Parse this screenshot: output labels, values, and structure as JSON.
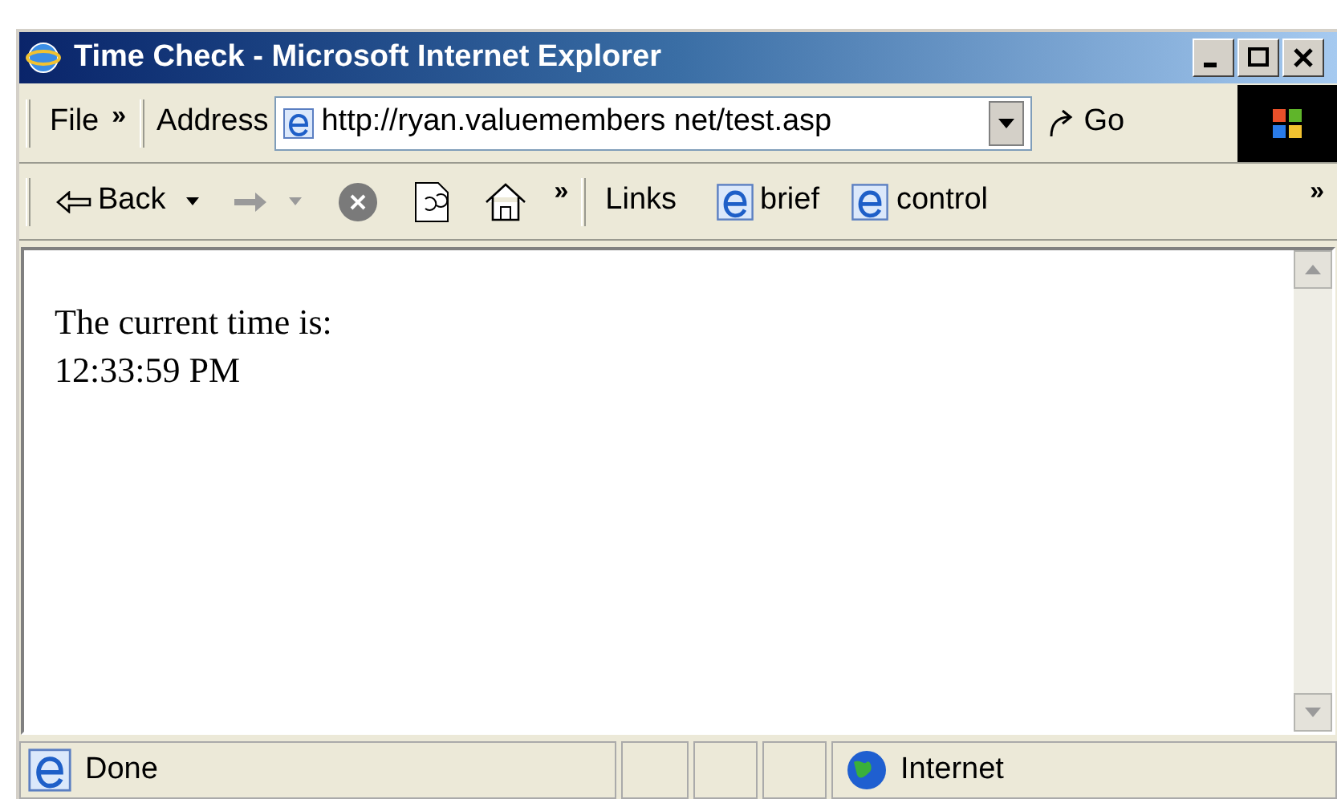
{
  "window": {
    "title": "Time Check - Microsoft Internet Explorer"
  },
  "menu": {
    "label": "File",
    "chevron": "»"
  },
  "address": {
    "label": "Address",
    "url": "http://ryan.valuemembers net/test.asp",
    "go": "Go"
  },
  "toolbar": {
    "back": "Back",
    "chevron": "»",
    "links_label": "Links",
    "links": [
      "brief",
      "control"
    ],
    "end_chevron": "»"
  },
  "page": {
    "lines": [
      "The current time is:",
      "12:33:59 PM"
    ]
  },
  "status_bar": {
    "text": "Done",
    "zone": "Internet"
  }
}
